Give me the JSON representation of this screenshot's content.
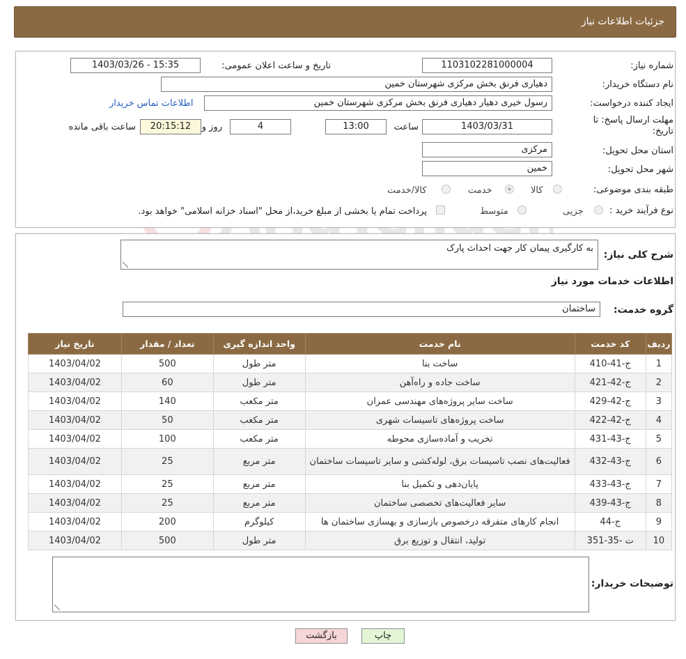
{
  "header": {
    "title": "جزئیات اطلاعات نیاز"
  },
  "form": {
    "need_number_label": "شماره نیاز:",
    "need_number": "1103102281000004",
    "announce_label": "تاریخ و ساعت اعلان عمومی:",
    "announce_value": "1403/03/26 - 15:35",
    "buyer_org_label": "نام دستگاه خریدار:",
    "buyer_org": "دهیاری فرنق بخش مرکزی شهرستان خمین",
    "creator_label": "ایجاد کننده درخواست:",
    "creator": "رسول خیری دهیار دهیاری فرنق بخش مرکزی شهرستان خمین",
    "contact_link": "اطلاعات تماس خریدار",
    "deadline_label_1": "مهلت ارسال پاسخ: تا",
    "deadline_label_2": "تاریخ:",
    "deadline_date": "1403/03/31",
    "time_label": "ساعت",
    "deadline_time": "13:00",
    "days_value": "4",
    "days_label": "روز و",
    "remaining_value": "20:15:12",
    "remaining_label": "ساعت باقی مانده",
    "province_label": "استان محل تحویل:",
    "province": "مرکزی",
    "city_label": "شهر محل تحویل:",
    "city": "خمین",
    "category_label": "طبقه بندی موضوعی:",
    "category_options": [
      "کالا",
      "خدمت",
      "کالا/خدمت"
    ],
    "purchase_type_label": "نوع فرآیند خرید :",
    "purchase_options": [
      "جزیی",
      "متوسط"
    ],
    "purchase_note": "پرداخت تمام یا بخشی از مبلغ خرید،از محل \"اسناد خزانه اسلامی\" خواهد بود."
  },
  "details": {
    "summary_label": "شرح کلی نیاز:",
    "summary_value": "به کارگیری پیمان کار جهت احداث پارک",
    "services_title": "اطلاعات خدمات مورد نیاز",
    "service_group_label": "گروه خدمت:",
    "service_group_value": "ساختمان",
    "table": {
      "headers": [
        "ردیف",
        "کد خدمت",
        "نام خدمت",
        "واحد اندازه گیری",
        "تعداد / مقدار",
        "تاریخ نیاز"
      ],
      "rows": [
        [
          "1",
          "ج-41-410",
          "ساخت بنا",
          "متر طول",
          "500",
          "1403/04/02"
        ],
        [
          "2",
          "ج-42-421",
          "ساخت جاده و راه‌آهن",
          "متر طول",
          "60",
          "1403/04/02"
        ],
        [
          "3",
          "ج-42-429",
          "ساخت سایر پروژه‌های مهندسی عمران",
          "متر مکعب",
          "140",
          "1403/04/02"
        ],
        [
          "4",
          "ج-42-422",
          "ساخت پروژه‌های تاسیسات شهری",
          "متر مکعب",
          "50",
          "1403/04/02"
        ],
        [
          "5",
          "ج-43-431",
          "تخریب و آماده‌سازی محوطه",
          "متر مکعب",
          "100",
          "1403/04/02"
        ],
        [
          "6",
          "ج-43-432",
          "فعالیت‌های نصب تاسیسات برق، لوله‌کشی و سایر تاسیسات ساختمان",
          "متر مربع",
          "25",
          "1403/04/02"
        ],
        [
          "7",
          "ج-43-433",
          "پایان‌دهی و تکمیل بنا",
          "متر مربع",
          "25",
          "1403/04/02"
        ],
        [
          "8",
          "ج-43-439",
          "سایر فعالیت‌های تخصصی ساختمان",
          "متر مربع",
          "25",
          "1403/04/02"
        ],
        [
          "9",
          "ج-44",
          "انجام کارهای متفرقه درخصوص بازسازی و بهسازی ساختمان ها",
          "کیلوگرم",
          "200",
          "1403/04/02"
        ],
        [
          "10",
          "ت -35-351",
          "تولید، انتقال و توزیع برق",
          "متر طول",
          "500",
          "1403/04/02"
        ]
      ]
    },
    "buyer_notes_label": "توضیحات خریدار:"
  },
  "buttons": {
    "print": "چاپ",
    "back": "بازگشت"
  },
  "watermark": {
    "text": "AriaTender.neT"
  },
  "colors": {
    "header_bg": "#8b6a43",
    "link": "#2660c4",
    "back_button": "#f6d6d6",
    "print_button": "#e2f6d6"
  }
}
